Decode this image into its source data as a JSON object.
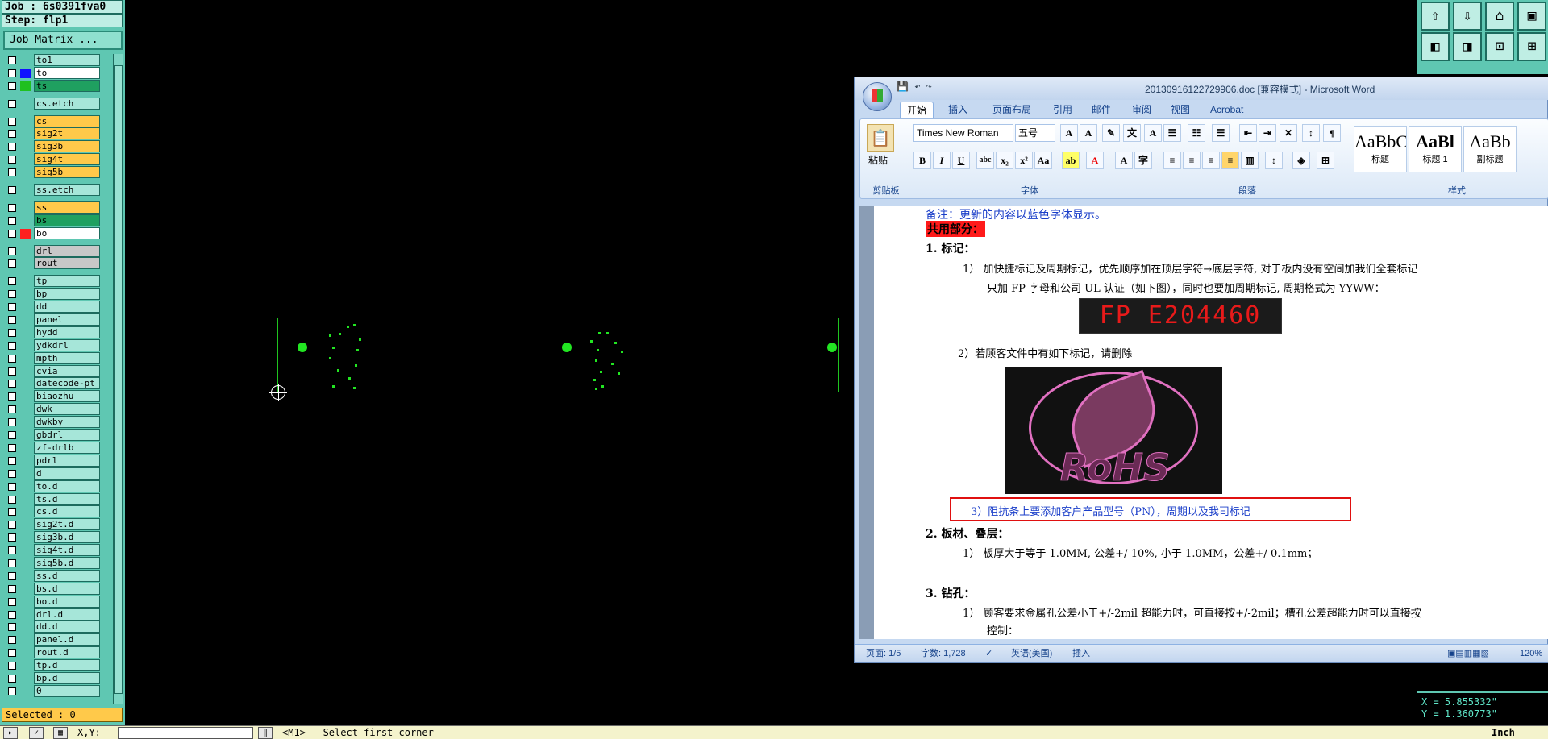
{
  "genesis": {
    "job": "Job : 6s0391fva0",
    "step": "Step: flp1",
    "job_matrix": "Job Matrix ...",
    "selected": "Selected : 0",
    "layers_groups": [
      [
        {
          "name": "to1",
          "color": "#5fc7b2"
        },
        {
          "name": "to",
          "color": "#1010ff",
          "bg": "#ffffff"
        },
        {
          "name": "ts",
          "color": "#20c020",
          "bg": "#1fa060"
        }
      ],
      [
        {
          "name": "cs.etch",
          "color": "#5fc7b2"
        }
      ],
      [
        {
          "name": "cs",
          "color": "#5fc7b2",
          "bg": "#ffc94a"
        },
        {
          "name": "sig2t",
          "color": "#5fc7b2",
          "bg": "#ffc94a"
        },
        {
          "name": "sig3b",
          "color": "#5fc7b2",
          "bg": "#ffc94a"
        },
        {
          "name": "sig4t",
          "color": "#5fc7b2",
          "bg": "#ffc94a"
        },
        {
          "name": "sig5b",
          "color": "#5fc7b2",
          "bg": "#ffc94a"
        }
      ],
      [
        {
          "name": "ss.etch",
          "color": "#5fc7b2"
        }
      ],
      [
        {
          "name": "ss",
          "color": "#5fc7b2",
          "bg": "#ffc94a"
        },
        {
          "name": "bs",
          "color": "#5fc7b2",
          "bg": "#1fa060"
        },
        {
          "name": "bo",
          "color": "#ff2020",
          "bg": "#ffffff"
        }
      ],
      [
        {
          "name": "drl",
          "color": "#5fc7b2",
          "bg": "#c8c8c8"
        },
        {
          "name": "rout",
          "color": "#5fc7b2",
          "bg": "#c8c8c8"
        }
      ],
      [
        {
          "name": "tp"
        },
        {
          "name": "bp"
        },
        {
          "name": "dd"
        },
        {
          "name": "panel"
        },
        {
          "name": "hydd"
        },
        {
          "name": "ydkdrl"
        },
        {
          "name": "mpth"
        },
        {
          "name": "cvia"
        },
        {
          "name": "datecode-pt"
        },
        {
          "name": "biaozhu"
        },
        {
          "name": "dwk"
        },
        {
          "name": "dwkby"
        },
        {
          "name": "gbdrl"
        },
        {
          "name": "zf-drlb"
        },
        {
          "name": "pdrl"
        },
        {
          "name": "d"
        },
        {
          "name": "to.d"
        },
        {
          "name": "ts.d"
        },
        {
          "name": "cs.d"
        },
        {
          "name": "sig2t.d"
        },
        {
          "name": "sig3b.d"
        },
        {
          "name": "sig4t.d"
        },
        {
          "name": "sig5b.d"
        },
        {
          "name": "ss.d"
        },
        {
          "name": "bs.d"
        },
        {
          "name": "bo.d"
        },
        {
          "name": "drl.d"
        },
        {
          "name": "dd.d"
        },
        {
          "name": "panel.d"
        },
        {
          "name": "rout.d"
        },
        {
          "name": "tp.d"
        },
        {
          "name": "bp.d"
        },
        {
          "name": "0"
        }
      ]
    ],
    "coords": {
      "x": "X = 5.855332\"",
      "y": "Y = 1.360773\""
    },
    "bottom": {
      "xy_label": "X,Y:",
      "prompt": "<M1> - Select first corner",
      "units": "Inch"
    }
  },
  "word": {
    "title": "20130916122729906.doc [兼容模式] - Microsoft Word",
    "tabs": [
      "开始",
      "插入",
      "页面布局",
      "引用",
      "邮件",
      "审阅",
      "视图",
      "Acrobat"
    ],
    "font_name": "Times New Roman",
    "font_size": "五号",
    "paste": "粘贴",
    "groups": {
      "clipboard": "剪贴板",
      "font": "字体",
      "paragraph": "段落",
      "styles": "样式"
    },
    "styles": [
      {
        "sample": "AaBbC",
        "name": "标题"
      },
      {
        "sample": "AaBl",
        "name": "标题 1"
      },
      {
        "sample": "AaBb",
        "name": "副标题"
      }
    ],
    "doc": {
      "note": "备注：更新的内容以蓝色字体显示。",
      "common": "共用部分：",
      "h1": "1.   标记：",
      "p1a": "1） 加快捷标记及周期标记，优先顺序加在顶层字符→底层字符, 对于板内没有空间加我们全套标记",
      "p1b": "只加 FP 字母和公司 UL 认证（如下图），同时也要加周期标记, 周期格式为 YYWW：",
      "ul_mark": "FP E204460",
      "p2": "2）若顾客文件中有如下标记，请删除",
      "rohs": "RoHS",
      "p3": "3）阻抗条上要添加客户产品型号（PN），周期以及我司标记",
      "h2": "2.   板材、叠层：",
      "p4": "1） 板厚大于等于 1.0MM, 公差+/-10%, 小于 1.0MM，公差+/-0.1mm；",
      "h3": "3.   钻孔：",
      "p5": "1） 顾客要求金属孔公差小于+/-2mil  超能力时，可直接按+/-2mil；槽孔公差超能力时可以直接按",
      "p5b": "控制："
    },
    "status": {
      "page": "页面: 1/5",
      "words": "字数: 1,728",
      "lang": "英语(美国)",
      "mode": "插入",
      "zoom": "120%"
    }
  }
}
